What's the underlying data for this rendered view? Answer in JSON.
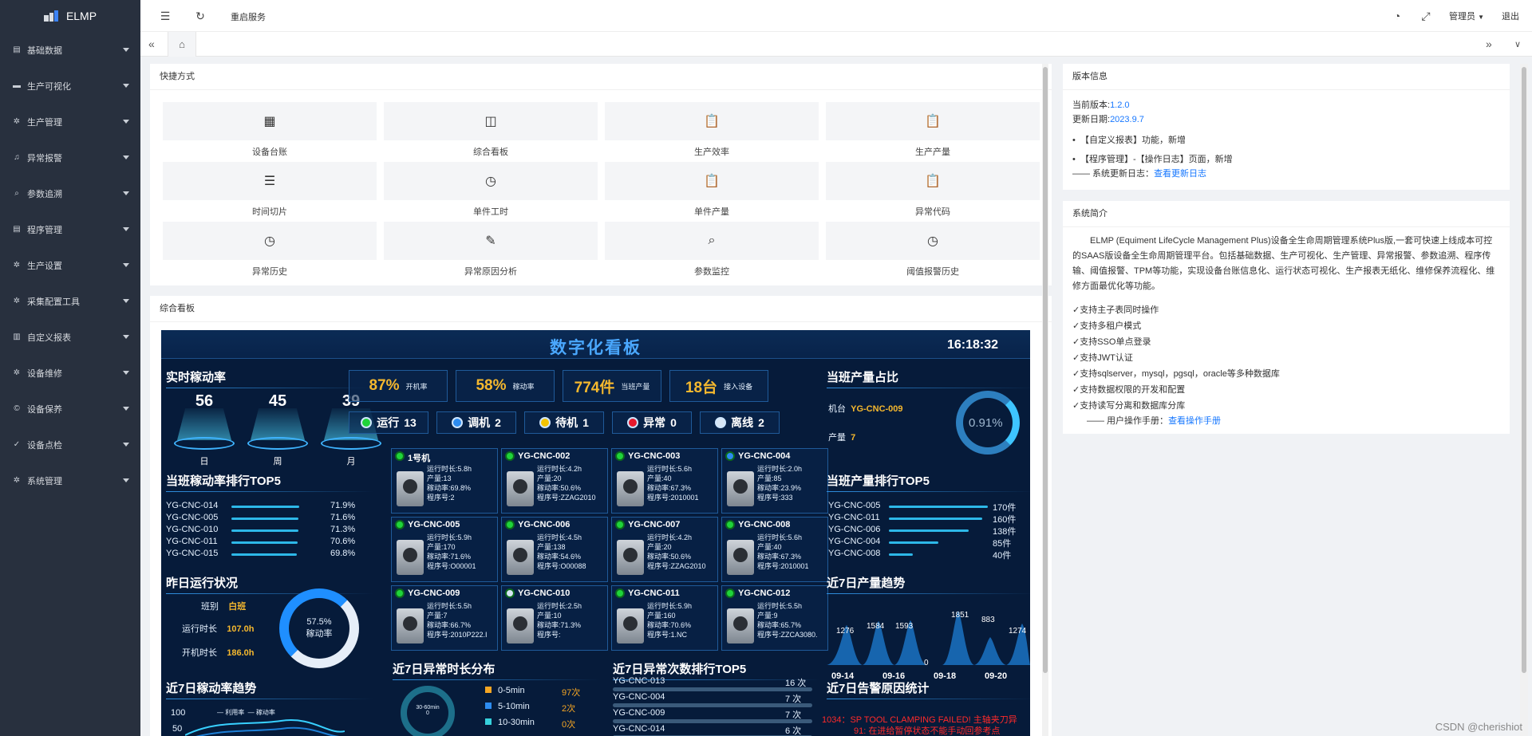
{
  "app": {
    "name": "ELMP"
  },
  "sidebar": {
    "items": [
      {
        "label": "基础数据",
        "icon": "grid-icon"
      },
      {
        "label": "生产可视化",
        "icon": "monitor-icon"
      },
      {
        "label": "生产管理",
        "icon": "gear-icon"
      },
      {
        "label": "异常报警",
        "icon": "bell-icon"
      },
      {
        "label": "参数追溯",
        "icon": "search-icon"
      },
      {
        "label": "程序管理",
        "icon": "folder-icon"
      },
      {
        "label": "生产设置",
        "icon": "gear-icon"
      },
      {
        "label": "采集配置工具",
        "icon": "gear-icon"
      },
      {
        "label": "自定义报表",
        "icon": "report-icon"
      },
      {
        "label": "设备维修",
        "icon": "gear-icon"
      },
      {
        "label": "设备保养",
        "icon": "copyright-icon"
      },
      {
        "label": "设备点检",
        "icon": "check-icon"
      },
      {
        "label": "系统管理",
        "icon": "gear-icon"
      }
    ]
  },
  "header": {
    "restart_label": "重启服务",
    "user_label": "管理员",
    "logout_label": "退出"
  },
  "quick": {
    "title": "快捷方式",
    "items": [
      {
        "label": "设备台账",
        "glyph": "▦"
      },
      {
        "label": "综合看板",
        "glyph": "◫"
      },
      {
        "label": "生产效率",
        "glyph": "📋"
      },
      {
        "label": "生产产量",
        "glyph": "📋"
      },
      {
        "label": "时间切片",
        "glyph": "☰"
      },
      {
        "label": "单件工时",
        "glyph": "◷"
      },
      {
        "label": "单件产量",
        "glyph": "📋"
      },
      {
        "label": "异常代码",
        "glyph": "📋"
      },
      {
        "label": "异常历史",
        "glyph": "◷"
      },
      {
        "label": "异常原因分析",
        "glyph": "✎"
      },
      {
        "label": "参数监控",
        "glyph": "⌕"
      },
      {
        "label": "阈值报警历史",
        "glyph": "◷"
      }
    ]
  },
  "dashboard": {
    "panel_title": "综合看板",
    "title": "数字化看板",
    "clock": "16:18:32",
    "sec_rate": "实时稼动率",
    "rates": [
      {
        "v": "56",
        "l": "日"
      },
      {
        "v": "45",
        "l": "周"
      },
      {
        "v": "39",
        "l": "月"
      }
    ],
    "kpis": [
      {
        "v": "87%",
        "u": "开机率"
      },
      {
        "v": "58%",
        "u": "稼动率"
      },
      {
        "v": "774件",
        "u": "当班产量"
      },
      {
        "v": "18台",
        "u": "接入设备"
      }
    ],
    "stats": [
      {
        "l": "运行",
        "v": "13",
        "color": "#1fd43a"
      },
      {
        "l": "调机",
        "v": "2",
        "color": "#2d8cf0"
      },
      {
        "l": "待机",
        "v": "1",
        "color": "#f5c400"
      },
      {
        "l": "异常",
        "v": "0",
        "color": "#e8192c"
      },
      {
        "l": "离线",
        "v": "2",
        "color": "#d8e6f5"
      }
    ],
    "sec_share": "当班产量占比",
    "share_machine_label": "机台",
    "share_machine": "YG-CNC-009",
    "share_output_label": "产量",
    "share_output": "7",
    "share_pct": "0.91%",
    "sec_top5": "当班稼动率排行TOP5",
    "top5": [
      {
        "n": "YG-CNC-014",
        "v": "71.9%",
        "p": 0.719
      },
      {
        "n": "YG-CNC-005",
        "v": "71.6%",
        "p": 0.716
      },
      {
        "n": "YG-CNC-010",
        "v": "71.3%",
        "p": 0.713
      },
      {
        "n": "YG-CNC-011",
        "v": "70.6%",
        "p": 0.706
      },
      {
        "n": "YG-CNC-015",
        "v": "69.8%",
        "p": 0.698
      }
    ],
    "sec_output_top5": "当班产量排行TOP5",
    "out_top5": [
      {
        "n": "YG-CNC-005",
        "v": "170件",
        "p": 1.0
      },
      {
        "n": "YG-CNC-011",
        "v": "160件",
        "p": 0.94
      },
      {
        "n": "YG-CNC-006",
        "v": "138件",
        "p": 0.81
      },
      {
        "n": "YG-CNC-004",
        "v": "85件",
        "p": 0.5
      },
      {
        "n": "YG-CNC-008",
        "v": "40件",
        "p": 0.24
      }
    ],
    "sec_yesterday": "昨日运行状况",
    "yesterday": {
      "shift_label": "班别",
      "shift": "白班",
      "run_label": "运行时长",
      "run": "107.0h",
      "on_label": "开机时长",
      "on": "186.0h",
      "pct": "57.5%",
      "pct_label": "稼动率"
    },
    "sec_trend7": "近7日产量趋势",
    "trend7_values": [
      "1276",
      "1584",
      "1593",
      "0",
      "1851",
      "883",
      "1274"
    ],
    "trend7_dates": [
      "09-14",
      "09-16",
      "09-18",
      "09-20"
    ],
    "sec_rate_trend": "近7日稼动率趋势",
    "rate_trend_axis": [
      "100",
      "50"
    ],
    "rate_trend_legend": [
      "利用率",
      "稼动率"
    ],
    "sec_abn_dist": "近7日异常时长分布",
    "abn_dist_center": "30-60min",
    "abn_dist_center_val": "0",
    "abn_dist": [
      {
        "l": "0-5min",
        "v": "97次",
        "color": "#f5a623"
      },
      {
        "l": "5-10min",
        "v": "2次",
        "color": "#2d8cf0"
      },
      {
        "l": "10-30min",
        "v": "0次",
        "color": "#36d1dc"
      }
    ],
    "sec_abn_top5": "近7日异常次数排行TOP5",
    "abn_top5": [
      {
        "n": "YG-CNC-013",
        "v": "16 次"
      },
      {
        "n": "YG-CNC-004",
        "v": "7 次"
      },
      {
        "n": "YG-CNC-009",
        "v": "7 次"
      },
      {
        "n": "YG-CNC-014",
        "v": "6 次"
      }
    ],
    "sec_alarm": "近7日告警原因统计",
    "alarm_lines": [
      "1034：SP TOOL CLAMPING FAILED!  主轴夹刀异",
      "91: 在进给暂停状态不能手动回参考点"
    ],
    "machines": [
      {
        "name": "1号机",
        "dot": "#1fd43a",
        "info": [
          "运行时长:5.8h",
          "产量:13",
          "稼动率:69.8%",
          "程序号:2"
        ]
      },
      {
        "name": "YG-CNC-002",
        "dot": "#1fd43a",
        "info": [
          "运行时长:4.2h",
          "产量:20",
          "稼动率:50.6%",
          "程序号:ZZAG2010"
        ]
      },
      {
        "name": "YG-CNC-003",
        "dot": "#1fd43a",
        "info": [
          "运行时长:5.6h",
          "产量:40",
          "稼动率:67.3%",
          "程序号:2010001"
        ]
      },
      {
        "name": "YG-CNC-004",
        "dot": "#2d8cf0",
        "info": [
          "运行时长:2.0h",
          "产量:85",
          "稼动率:23.9%",
          "程序号:333"
        ]
      },
      {
        "name": "YG-CNC-005",
        "dot": "#1fd43a",
        "info": [
          "运行时长:5.9h",
          "产量:170",
          "稼动率:71.6%",
          "程序号:O00001"
        ]
      },
      {
        "name": "YG-CNC-006",
        "dot": "#1fd43a",
        "info": [
          "运行时长:4.5h",
          "产量:138",
          "稼动率:54.6%",
          "程序号:O00088"
        ]
      },
      {
        "name": "YG-CNC-007",
        "dot": "#1fd43a",
        "info": [
          "运行时长:4.2h",
          "产量:20",
          "稼动率:50.6%",
          "程序号:ZZAG2010"
        ]
      },
      {
        "name": "YG-CNC-008",
        "dot": "#1fd43a",
        "info": [
          "运行时长:5.6h",
          "产量:40",
          "稼动率:67.3%",
          "程序号:2010001"
        ]
      },
      {
        "name": "YG-CNC-009",
        "dot": "#1fd43a",
        "info": [
          "运行时长:5.5h",
          "产量:7",
          "稼动率:66.7%",
          "程序号:2010P222.I"
        ]
      },
      {
        "name": "YG-CNC-010",
        "dot": "#d8e6f5",
        "info": [
          "运行时长:2.5h",
          "产量:10",
          "稼动率:71.3%",
          "程序号:"
        ]
      },
      {
        "name": "YG-CNC-011",
        "dot": "#1fd43a",
        "info": [
          "运行时长:5.9h",
          "产量:160",
          "稼动率:70.6%",
          "程序号:1.NC"
        ]
      },
      {
        "name": "YG-CNC-012",
        "dot": "#1fd43a",
        "info": [
          "运行时长:5.5h",
          "产量:9",
          "稼动率:65.7%",
          "程序号:ZZCA3080."
        ]
      }
    ]
  },
  "version": {
    "title": "版本信息",
    "cur_label": "当前版本:",
    "cur": "1.2.0",
    "date_label": "更新日期:",
    "date": "2023.9.7",
    "changes": [
      "【自定义报表】功能，新增",
      "【程序管理】-【操作日志】页面，新增"
    ],
    "log_label": "—— 系统更新日志：",
    "log_link": "查看更新日志"
  },
  "intro": {
    "title": "系统简介",
    "para": "ELMP (Equiment LifeCycle Management Plus)设备全生命周期管理系统Plus版,一套可快速上线成本可控的SAAS版设备全生命周期管理平台。包括基础数据、生产可视化、生产管理、异常报警、参数追溯、程序传输、阈值报警、TPM等功能，实现设备台账信息化、运行状态可视化、生产报表无纸化、维修保养流程化、维修方面最优化等功能。",
    "features": [
      "支持主子表同时操作",
      "支持多租户模式",
      "支持SSO单点登录",
      "支持JWT认证",
      "支持sqlserver，mysql，pgsql，oracle等多种数据库",
      "支持数据权限的开发和配置",
      "支持读写分离和数据库分库"
    ],
    "manual_label": "—— 用户操作手册：",
    "manual_link": "查看操作手册"
  },
  "watermark": "CSDN @cherishiot"
}
